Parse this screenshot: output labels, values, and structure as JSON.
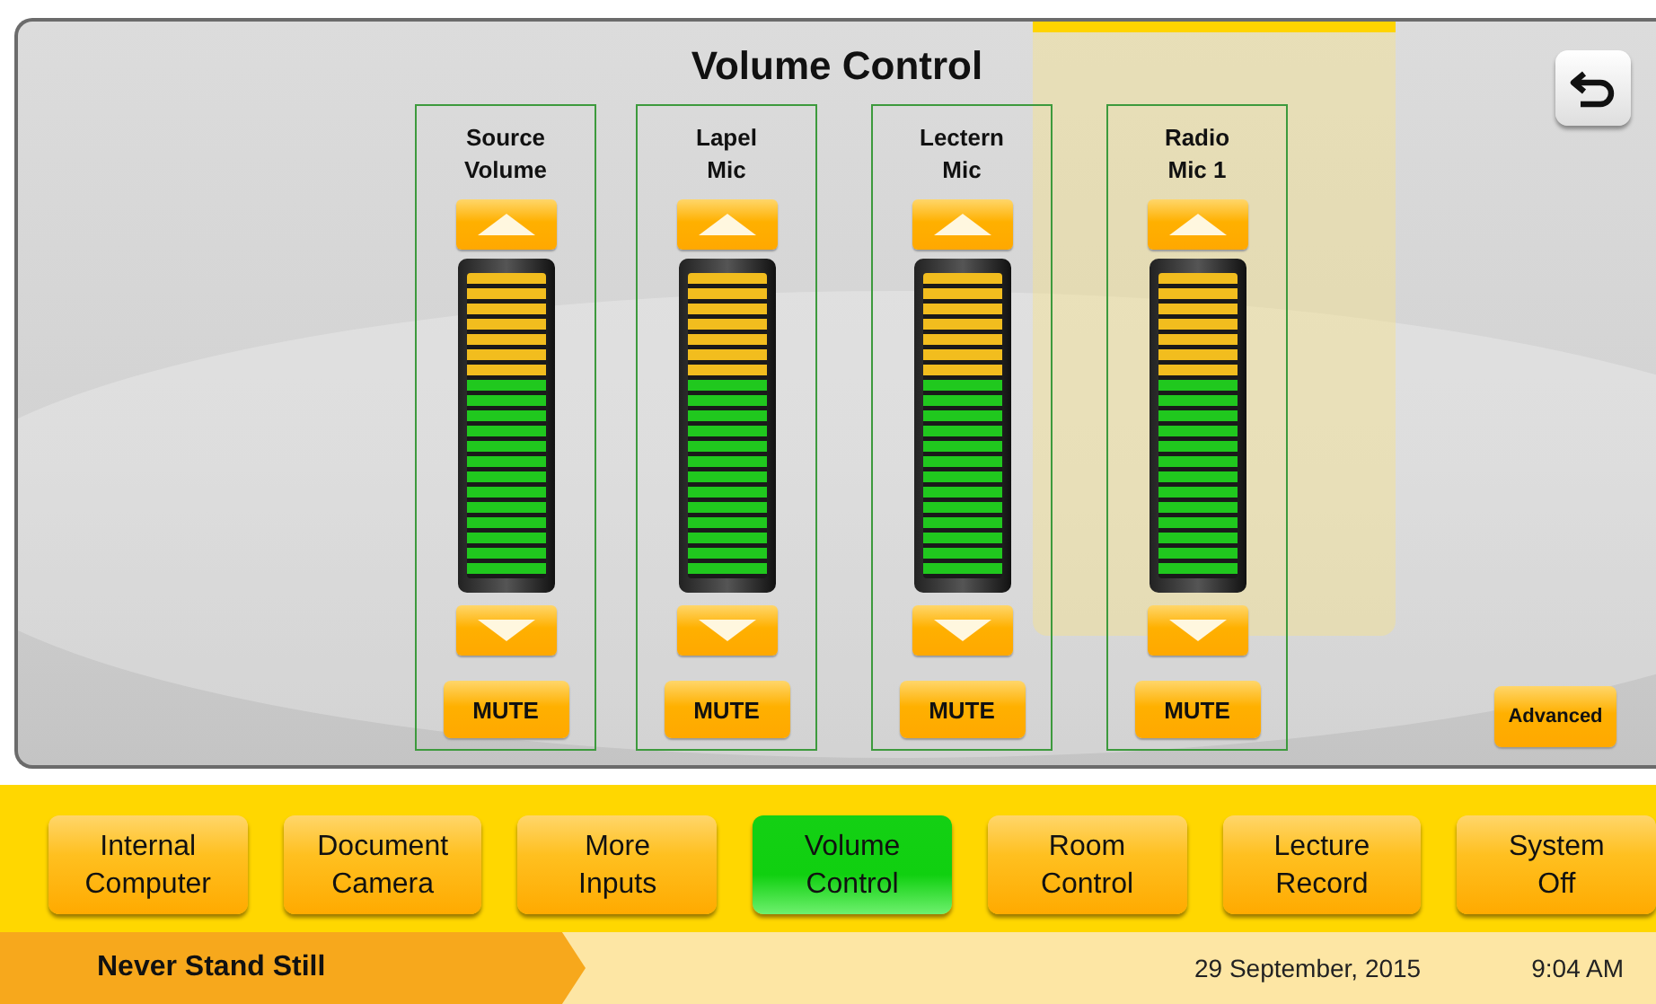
{
  "title": "Volume Control",
  "channels": [
    {
      "label_lines": [
        "Source",
        "Volume"
      ],
      "level": 1,
      "muted": false,
      "mute_label": "MUTE"
    },
    {
      "label_lines": [
        "Lapel",
        "Mic"
      ],
      "level": 1,
      "muted": false,
      "mute_label": "MUTE"
    },
    {
      "label_lines": [
        "Lectern",
        "Mic"
      ],
      "level": 1,
      "muted": false,
      "mute_label": "MUTE"
    },
    {
      "label_lines": [
        "Radio",
        "Mic 1"
      ],
      "level": 1,
      "muted": false,
      "mute_label": "MUTE"
    }
  ],
  "advanced_button": "Advanced",
  "nav": [
    {
      "lines": [
        "Internal",
        "Computer"
      ],
      "selected": false
    },
    {
      "lines": [
        "Document",
        "Camera"
      ],
      "selected": false
    },
    {
      "lines": [
        "More",
        "Inputs"
      ],
      "selected": false
    },
    {
      "lines": [
        "Volume",
        "Control"
      ],
      "selected": true
    },
    {
      "lines": [
        "Room",
        "Control"
      ],
      "selected": false
    },
    {
      "lines": [
        "Lecture",
        "Record"
      ],
      "selected": false
    },
    {
      "lines": [
        "System",
        "Off"
      ],
      "selected": false
    }
  ],
  "status_bar": {
    "slogan": "Never Stand Still",
    "date": "29 September, 2015",
    "time": "9:04 AM"
  }
}
